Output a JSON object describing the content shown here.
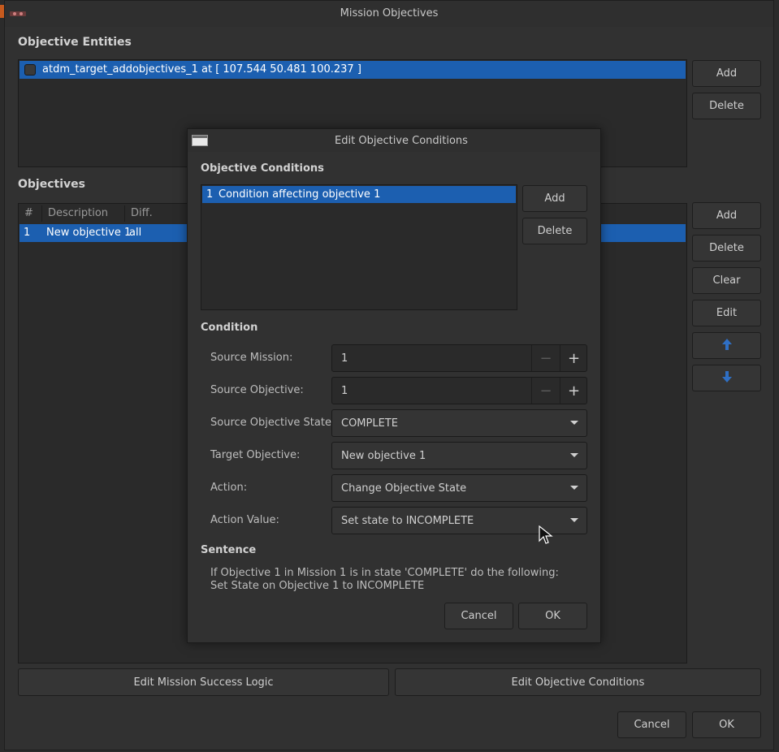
{
  "window": {
    "title": "Mission Objectives"
  },
  "entities": {
    "section_label": "Objective Entities",
    "items": [
      {
        "label": "atdm_target_addobjectives_1 at [ 107.544 50.481 100.237 ]",
        "checked": false
      }
    ],
    "add_label": "Add",
    "delete_label": "Delete"
  },
  "objectives": {
    "section_label": "Objectives",
    "columns": [
      "#",
      "Description",
      "Diff."
    ],
    "rows": [
      {
        "num": "1",
        "description": "New objective 1",
        "diff": "all"
      }
    ],
    "add_label": "Add",
    "delete_label": "Delete",
    "clear_label": "Clear",
    "edit_label": "Edit",
    "move_up_icon": "arrow-up-icon",
    "move_down_icon": "arrow-down-icon"
  },
  "footer": {
    "success_logic_label": "Edit Mission Success Logic",
    "objective_conditions_label": "Edit Objective Conditions",
    "cancel_label": "Cancel",
    "ok_label": "OK"
  },
  "dialog": {
    "title": "Edit Objective Conditions",
    "conditions_label": "Objective Conditions",
    "conditions": [
      {
        "num": "1",
        "label": "Condition affecting objective 1"
      }
    ],
    "add_label": "Add",
    "delete_label": "Delete",
    "condition_label": "Condition",
    "source_mission_label": "Source Mission:",
    "source_mission_value": "1",
    "source_objective_label": "Source Objective:",
    "source_objective_value": "1",
    "source_state_label": "Source Objective State:",
    "source_state_value": "COMPLETE",
    "target_objective_label": "Target Objective:",
    "target_objective_value": "New objective 1",
    "action_label": "Action:",
    "action_value": "Change Objective State",
    "action_value_label": "Action Value:",
    "action_value_value": "Set state to INCOMPLETE",
    "sentence_label": "Sentence",
    "sentence_line1": "If Objective 1 in Mission 1 is in state 'COMPLETE' do the following:",
    "sentence_line2": "Set State on Objective 1 to INCOMPLETE",
    "cancel_label": "Cancel",
    "ok_label": "OK"
  },
  "colors": {
    "accent": "#1c5fb0",
    "background": "#313131",
    "panel": "#2a2a2a",
    "arrow_blue": "#2f6fc4"
  }
}
